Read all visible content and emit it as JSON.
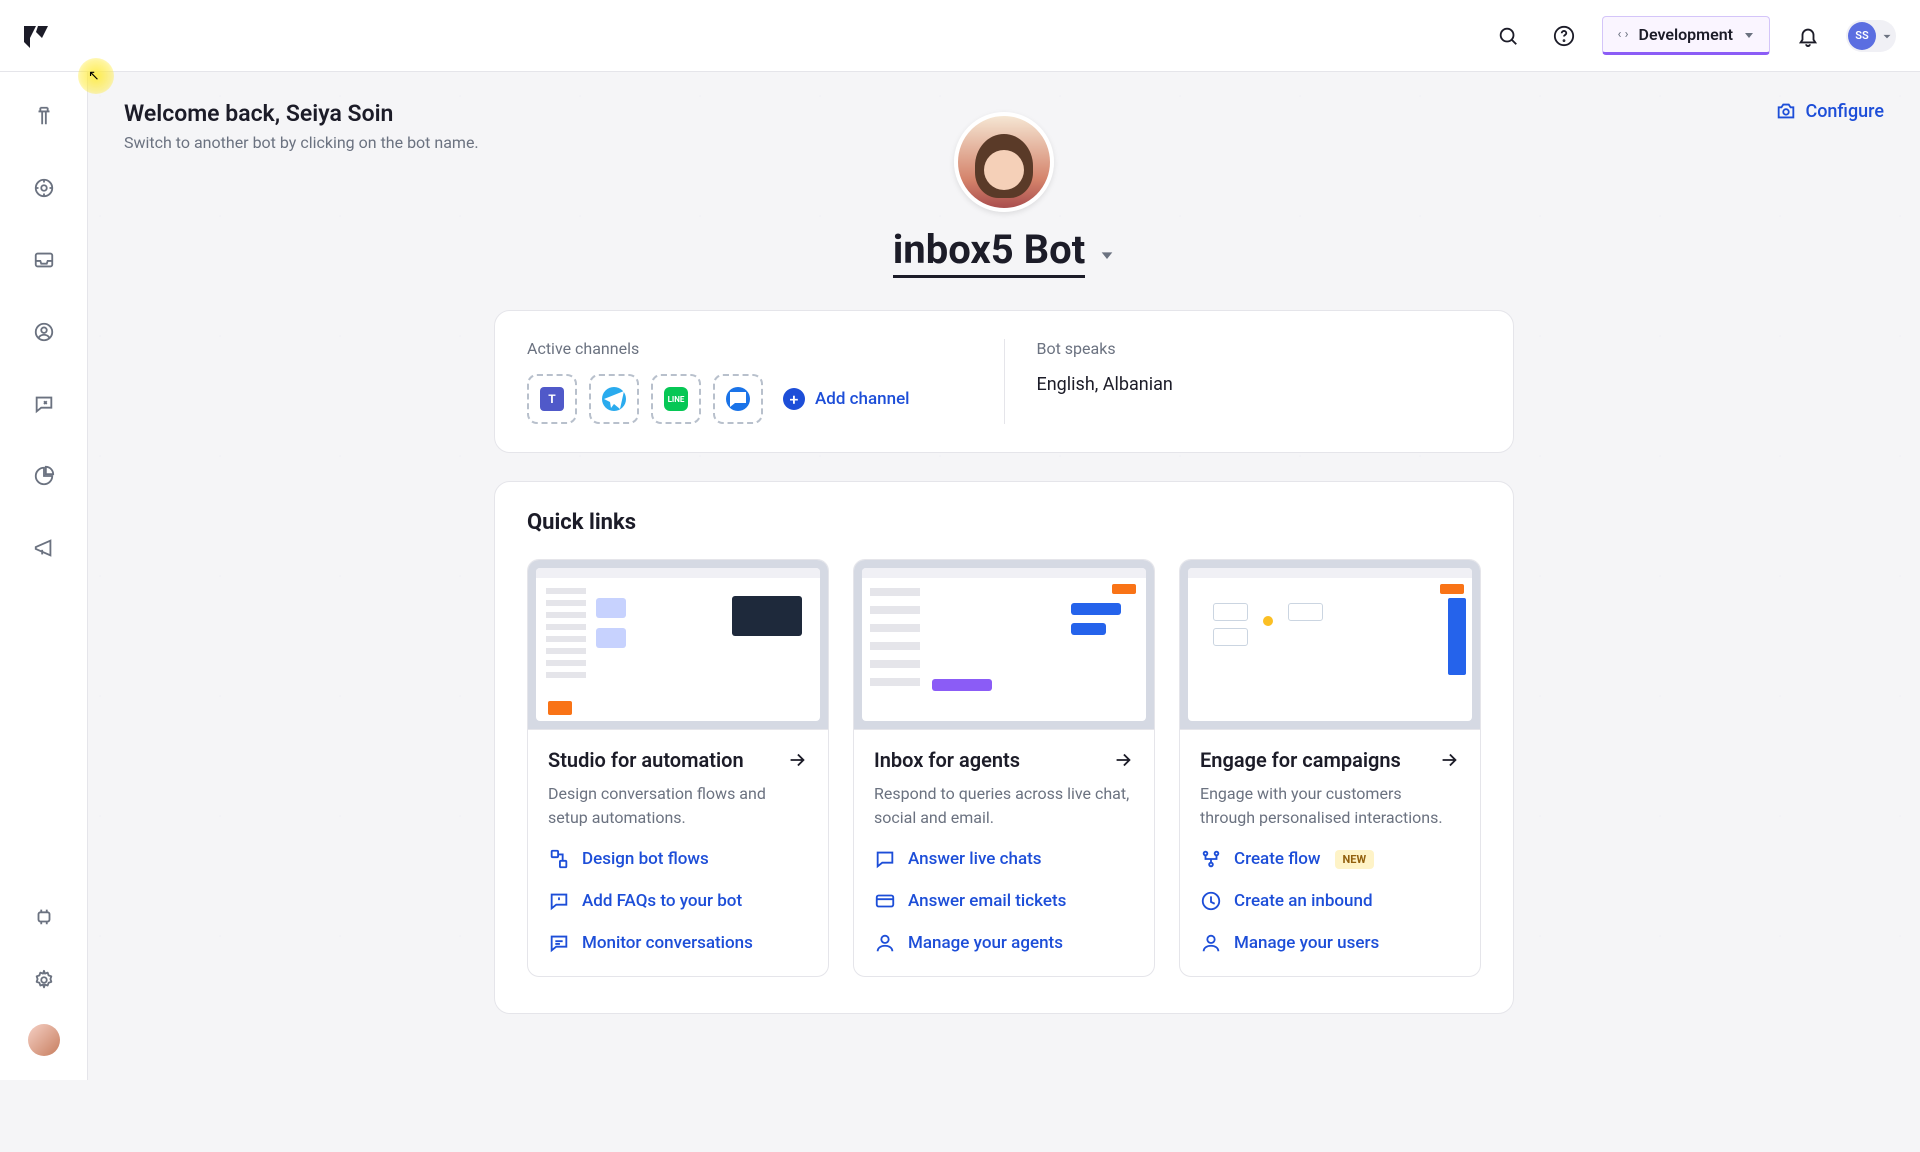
{
  "header": {
    "env_label": "Development",
    "avatar_initials": "SS"
  },
  "welcome": {
    "title": "Welcome back, Seiya Soin",
    "subtitle": "Switch to another bot by clicking on the bot name.",
    "configure": "Configure"
  },
  "bot": {
    "name": "inbox5 Bot"
  },
  "info": {
    "channels_label": "Active channels",
    "add_channel": "Add channel",
    "speaks_label": "Bot speaks",
    "languages": "English, Albanian"
  },
  "quick": {
    "title": "Quick links",
    "cards": [
      {
        "title": "Studio for automation",
        "desc": "Design conversation flows and setup automations.",
        "links": [
          {
            "icon": "flow",
            "label": "Design bot flows"
          },
          {
            "icon": "faq",
            "label": "Add FAQs to your bot"
          },
          {
            "icon": "monitor",
            "label": "Monitor conversations"
          }
        ]
      },
      {
        "title": "Inbox for agents",
        "desc": "Respond to queries across live chat, social and email.",
        "links": [
          {
            "icon": "chat",
            "label": "Answer live chats"
          },
          {
            "icon": "ticket",
            "label": "Answer email tickets"
          },
          {
            "icon": "agent",
            "label": "Manage your agents"
          }
        ]
      },
      {
        "title": "Engage for campaigns",
        "desc": "Engage with your customers through personalised interactions.",
        "links": [
          {
            "icon": "create",
            "label": "Create flow",
            "badge": "NEW"
          },
          {
            "icon": "inbound",
            "label": "Create an inbound"
          },
          {
            "icon": "users",
            "label": "Manage your users"
          }
        ]
      }
    ]
  }
}
